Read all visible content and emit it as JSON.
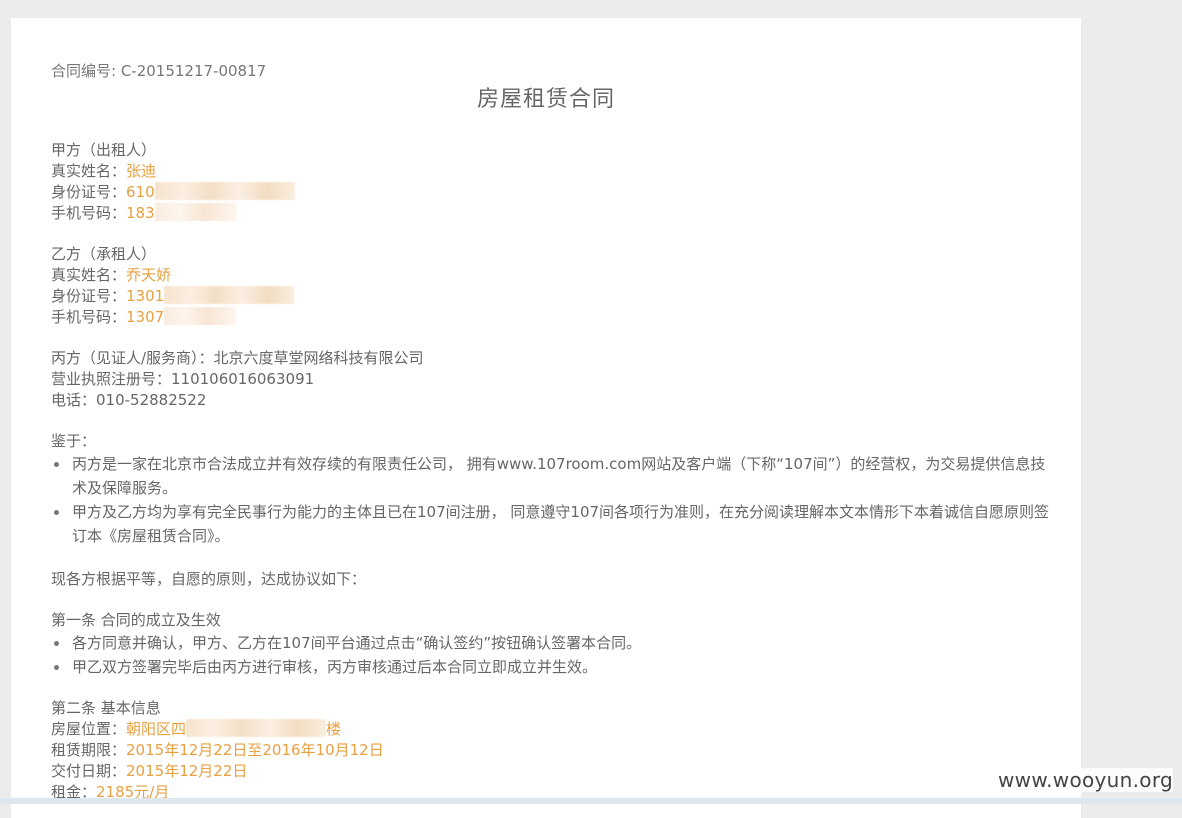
{
  "contract_no": "合同编号: C-20151217-00817",
  "title": "房屋租赁合同",
  "party_a": {
    "heading": "甲方（出租人）",
    "name_label": "真实姓名：",
    "name": "张迪",
    "id_label": "身份证号：",
    "id_prefix": "610",
    "phone_label": "手机号码：",
    "phone_prefix": "183"
  },
  "party_b": {
    "heading": "乙方（承租人）",
    "name_label": "真实姓名：",
    "name": "乔天娇",
    "id_label": "身份证号：",
    "id_prefix": "1301",
    "phone_label": "手机号码：",
    "phone_prefix": "1307"
  },
  "party_c": {
    "line1": "丙方（见证人/服务商）：北京六度草堂网络科技有限公司",
    "line2": "营业执照注册号：110106016063091",
    "line3": "电话：010-52882522"
  },
  "whereas": {
    "heading": "鉴于：",
    "items": [
      "丙方是一家在北京市合法成立并有效存续的有限责任公司， 拥有www.107room.com网站及客户端（下称“107间”）的经营权，为交易提供信息技术及保障服务。",
      "甲方及乙方均为享有完全民事行为能力的主体且已在107间注册， 同意遵守107间各项行为准则，在充分阅读理解本文本情形下本着诚信自愿原则签订本《房屋租赁合同》。"
    ]
  },
  "agreement_intro": "现各方根据平等，自愿的原则，达成协议如下：",
  "article1": {
    "heading": "第一条 合同的成立及生效",
    "items": [
      "各方同意并确认，甲方、乙方在107间平台通过点击“确认签约”按钮确认签署本合同。",
      "甲乙双方签署完毕后由丙方进行审核，丙方审核通过后本合同立即成立并生效。"
    ]
  },
  "article2": {
    "heading": "第二条 基本信息",
    "location_label": "房屋位置：",
    "location_prefix": "朝阳区四",
    "location_suffix": "楼",
    "term_label": "租赁期限：",
    "term_value": "2015年12月22日至2016年10月12日",
    "delivery_label": "交付日期：",
    "delivery_value": "2015年12月22日",
    "rent_label": "租金：",
    "rent_value": "2185元/月"
  },
  "watermark": "www.wooyun.org"
}
